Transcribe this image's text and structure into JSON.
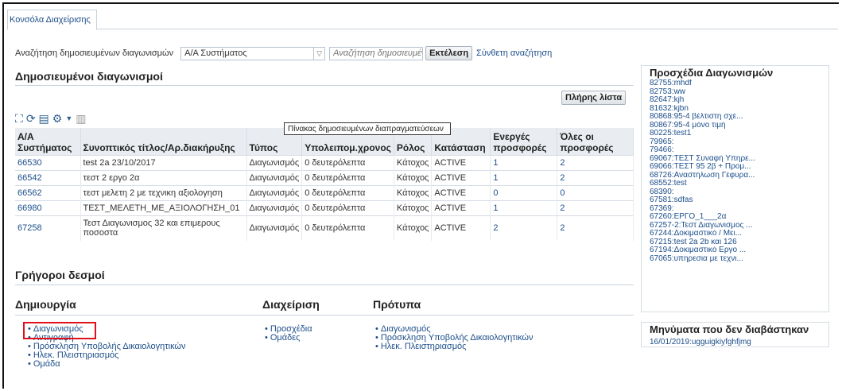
{
  "tabs": [
    {
      "label": "Κονσόλα Διαχείρισης"
    }
  ],
  "search": {
    "label": "Αναζήτηση δημοσιευμένων διαγωνισμών",
    "select_value": "Α/Α Συστήματος",
    "placeholder": "Αναζήτηση δημοσιευμένω",
    "run_label": "Εκτέλεση",
    "advanced_label": "Σύνθετη αναζήτηση"
  },
  "published": {
    "title": "Δημοσιευμένοι διαγωνισμοί",
    "full_list_label": "Πλήρης λίστα",
    "tooltip": "Πίνακας δημοσιευμένων διαπραγματεύσεων",
    "columns": [
      "Α/Α Συστήματος",
      "Συνοπτικός τίτλος/Αρ.διακήρυξης",
      "Τύπος",
      "Υπολειπομ.χρονος",
      "Ρόλος",
      "Κατάσταση",
      "Ενεργές προσφορές",
      "Όλες οι προσφορές"
    ],
    "rows": [
      {
        "id": "66530",
        "title": "test 2a 23/10/2017",
        "type": "Διαγωνισμός",
        "remaining": "0 δευτερόλεπτα",
        "role": "Κάτοχος",
        "status": "ACTIVE",
        "active": "1",
        "all": "2"
      },
      {
        "id": "66542",
        "title": "τεστ 2 εργο 2α",
        "type": "Διαγωνισμός",
        "remaining": "0 δευτερόλεπτα",
        "role": "Κάτοχος",
        "status": "ACTIVE",
        "active": "1",
        "all": "2"
      },
      {
        "id": "66562",
        "title": "τεστ μελετη 2 με τεχνικη αξιολογηση",
        "type": "Διαγωνισμός",
        "remaining": "0 δευτερόλεπτα",
        "role": "Κάτοχος",
        "status": "ACTIVE",
        "active": "0",
        "all": "0"
      },
      {
        "id": "66980",
        "title": "ΤΕΣΤ_ΜΕΛΕΤΗ_ΜΕ_ΑΞΙΟΛΟΓΗΣΗ_01",
        "type": "Διαγωνισμός",
        "remaining": "0 δευτερόλεπτα",
        "role": "Κάτοχος",
        "status": "ACTIVE",
        "active": "1",
        "all": "2"
      },
      {
        "id": "67258",
        "title": "Τεστ Διαγωνισμος 32 και επιμερους ποσοστα",
        "type": "Διαγωνισμός",
        "remaining": "0 δευτερόλεπτα",
        "role": "Κάτοχος",
        "status": "ACTIVE",
        "active": "2",
        "all": "2"
      }
    ]
  },
  "quick_links": {
    "title": "Γρήγοροι δεσμοί",
    "create": {
      "title": "Δημιουργία",
      "items": [
        "Διαγωνισμός",
        "Αντιγραφή",
        "Πρόσκληση Υποβολής Δικαιολογητικών",
        "Ηλεκ. Πλειστηριασμός",
        "Ομάδα"
      ]
    },
    "manage": {
      "title": "Διαχείριση",
      "items": [
        "Προσχέδια",
        "Ομάδες"
      ]
    },
    "templates": {
      "title": "Πρότυπα",
      "items": [
        "Διαγωνισμός",
        "Πρόσκληση Υποβολής Δικαιολογητικών",
        "Ηλεκ. Πλειστηριασμός"
      ]
    }
  },
  "drafts": {
    "title": "Προσχέδια Διαγωνισμών",
    "items": [
      "82755:mhdf",
      "82753:ww",
      "82647:kjh",
      "81632:kjbn",
      "80868:95-4 βέλτιστη σχέ...",
      "80867:95-4 μόνο τιμή",
      "80225:test1",
      "79965:",
      "79466:",
      "69067:ΤΕΣΤ Συναφή Υπηρε...",
      "69066:ΤΕΣΤ 95 2β + Προμ...",
      "68726:Αναστήλωση Γέφυρα...",
      "68552:test",
      "68390:",
      "67581:sdfas",
      "67369:",
      "67260:ΕΡΓΟ_1___2α",
      "67257-2:Τεστ Διαγωνισμος ...",
      "67244:Δοκιμαστικό / Μει...",
      "67215:test 2a 2b και 126",
      "67194:Δοκιμαστικό Εργο ...",
      "67065:υπηρεσια με τεχνι..."
    ]
  },
  "messages": {
    "title": "Μηνύματα που δεν διαβάστηκαν",
    "items": [
      "16/01/2019:ugguigkiyfghfjmg"
    ]
  },
  "colors": {
    "link": "#1c4e8a",
    "header_bg": "#e9edf1",
    "highlight": "#e0101a"
  }
}
